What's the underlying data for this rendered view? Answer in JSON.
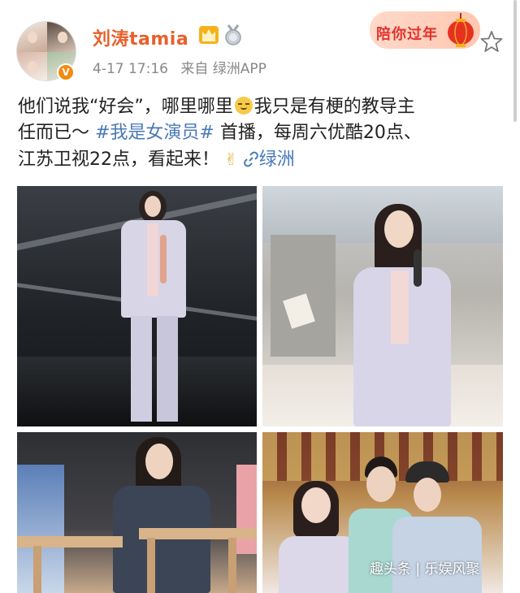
{
  "user": {
    "name": "刘涛tamia",
    "verified_badge": "V"
  },
  "meta": {
    "timestamp": "4-17 17:16",
    "source": "来自 绿洲APP"
  },
  "promo": {
    "label": "陪你过年"
  },
  "post": {
    "line1": "他们说我“好会”，哪里哪里",
    "line1b": "我只是有梗的教导主",
    "line2a": "任而已～ ",
    "hashtag": "#我是女演员#",
    "line2b": " 首播，每周六优酷20点、",
    "line3a": "江苏卫视22点，看起来！",
    "link_label": "绿洲"
  },
  "watermark": "趣头条 | 乐娱风聚",
  "colors": {
    "username": "#e8602c",
    "link": "#4879b8",
    "meta": "#888888",
    "promo_text": "#e4312b"
  },
  "icons": [
    "crown-icon",
    "medal-icon",
    "lantern-icon",
    "star-icon",
    "smile-emoji-icon",
    "victory-hand-icon",
    "link-icon"
  ]
}
